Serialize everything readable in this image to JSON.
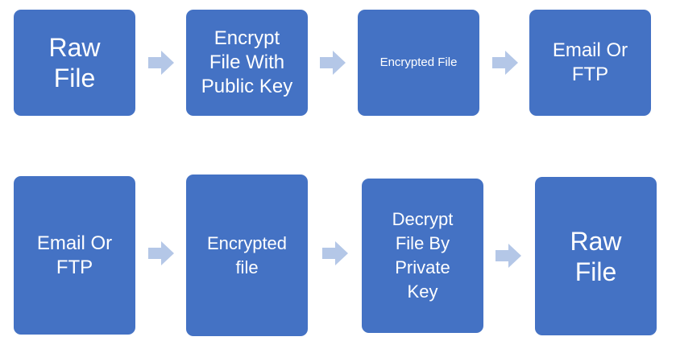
{
  "colors": {
    "box": "#4472c4",
    "arrow": "#b4c7e7",
    "text": "#ffffff"
  },
  "row1": {
    "step1": "Raw\nFile",
    "step2": "Encrypt\nFile With\nPublic Key",
    "step3": "Encrypted File",
    "step4": "Email Or\nFTP"
  },
  "row2": {
    "step1": "Email Or\nFTP",
    "step2": "Encrypted\nfile",
    "step3": "Decrypt\nFile By\nPrivate\nKey",
    "step4": "Raw\nFile"
  },
  "connectors": {
    "icon": "right-arrow-icon"
  }
}
